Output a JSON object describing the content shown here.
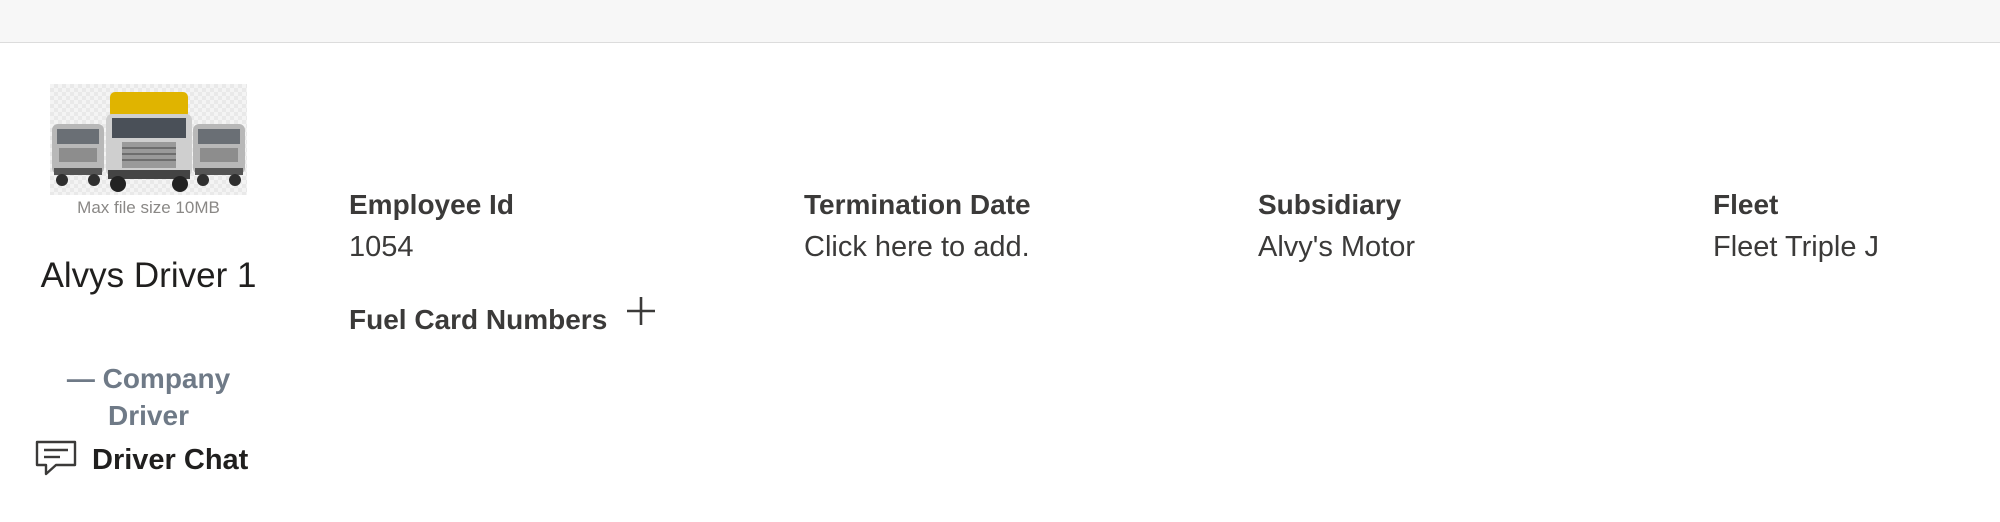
{
  "avatar": {
    "icon": "truck-fleet-image",
    "max_size": "Max file size 10MB"
  },
  "driver": {
    "name": "Alvys Driver 1",
    "type": "— Company Driver"
  },
  "chat": {
    "icon": "chat-icon",
    "label": "Driver Chat"
  },
  "fields": {
    "employee_id": {
      "label": "Employee Id",
      "value": "1054"
    },
    "termination_date": {
      "label": "Termination Date",
      "value": "Click here to add."
    },
    "subsidiary": {
      "label": "Subsidiary",
      "value": "Alvy's Motor"
    },
    "fleet": {
      "label": "Fleet",
      "value": "Fleet Triple J"
    }
  },
  "fuel_cards": {
    "label": "Fuel Card Numbers",
    "add_icon": "plus-icon"
  },
  "colors": {
    "truck_accent": "#e0b400",
    "muted_text": "#6f7a87"
  }
}
